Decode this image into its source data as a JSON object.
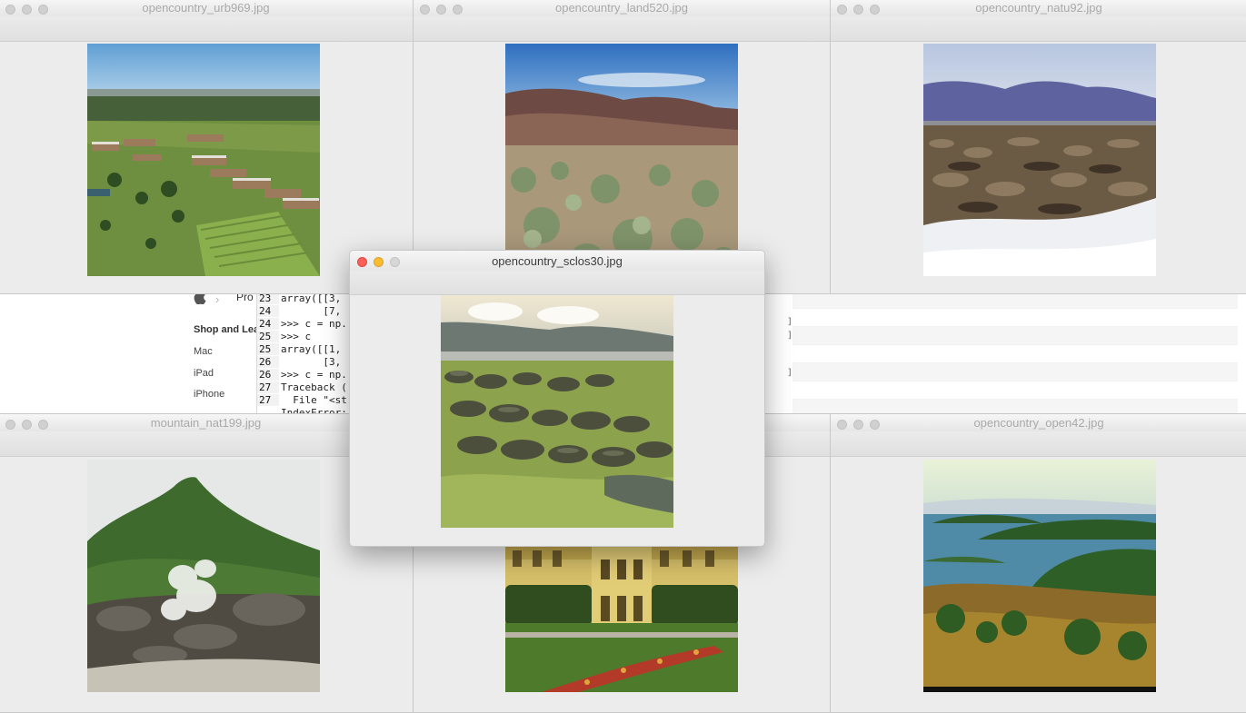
{
  "windows": [
    {
      "title": "opencountry_urb969.jpg",
      "image": "aerial-campus-landscape"
    },
    {
      "title": "opencountry_land520.jpg",
      "image": "desert-mountains-landscape"
    },
    {
      "title": "opencountry_natu92.jpg",
      "image": "salt-flat-mountains-landscape"
    },
    {
      "title": "mountain_nat199.jpg",
      "image": "volcano-steam-landscape"
    },
    {
      "title": "opencountry_open42.jpg",
      "image": "lake-islands-landscape"
    },
    {
      "title": "",
      "image": "palace-garden-landscape"
    }
  ],
  "active_window": {
    "title": "opencountry_sclos30.jpg",
    "image": "mossy-boulders-shore"
  },
  "browser": {
    "breadcrumb": "Pro",
    "shop_title": "Shop and Lea",
    "items": [
      "Mac",
      "iPad",
      "iPhone"
    ]
  },
  "terminal": {
    "lines": [
      {
        "num": "23",
        "text": "array([[3, "
      },
      {
        "num": "24",
        "text": "       [7, "
      },
      {
        "num": "24",
        "text": ">>> c = np."
      },
      {
        "num": "25",
        "text": ">>> c"
      },
      {
        "num": "25",
        "text": "array([[1, "
      },
      {
        "num": "26",
        "text": "       [3, "
      },
      {
        "num": "26",
        "text": ">>> c = np."
      },
      {
        "num": "27",
        "text": "Traceback ("
      },
      {
        "num": "27",
        "text": "  File \"<st"
      },
      {
        "num": "",
        "text": "IndexError:"
      }
    ]
  },
  "colors": {
    "close": "#fc5f57",
    "minimize": "#fdbb2e",
    "inactive": "#d0d0d0"
  }
}
